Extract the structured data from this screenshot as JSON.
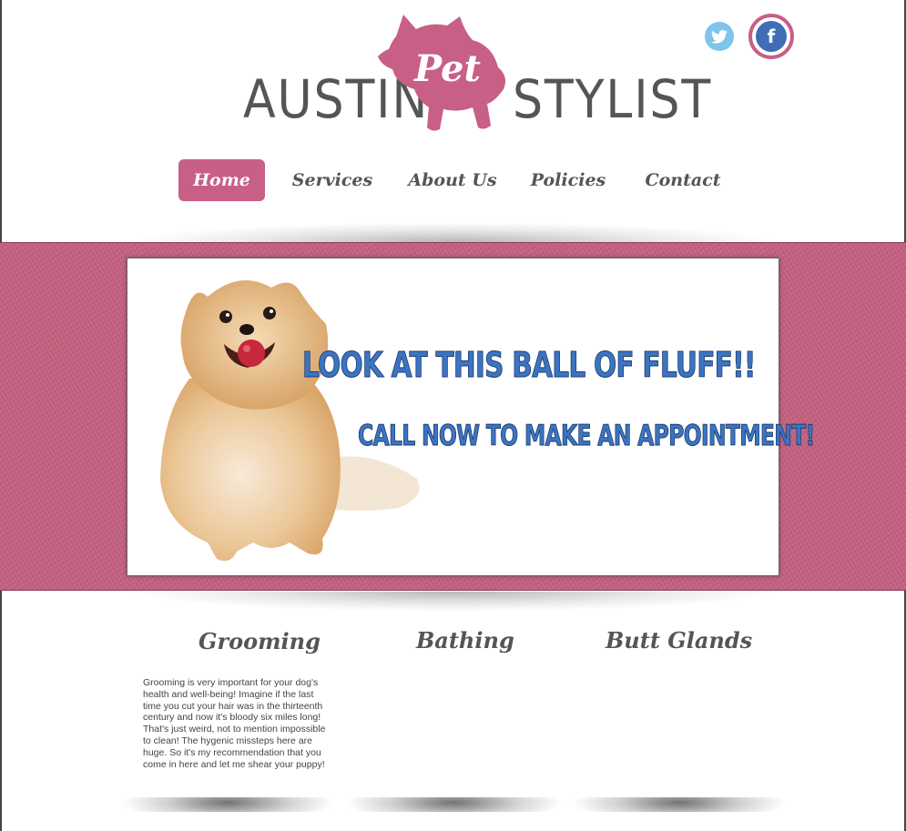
{
  "header": {
    "logo_left": "AUSTIN",
    "logo_middle": "Pet",
    "logo_right": "STYLIST",
    "brand_color": "#c75f86",
    "social": [
      {
        "name": "twitter",
        "icon": "twitter-bird-icon",
        "color": "#7fc4ea"
      },
      {
        "name": "facebook",
        "icon": "facebook-f-icon",
        "glyph": "f",
        "color": "#3f6eb5"
      }
    ]
  },
  "nav": {
    "items": [
      {
        "label": "Home",
        "active": true
      },
      {
        "label": "Services",
        "active": false
      },
      {
        "label": "About Us",
        "active": false
      },
      {
        "label": "Policies",
        "active": false
      },
      {
        "label": "Contact",
        "active": false
      }
    ]
  },
  "banner": {
    "headline": "LOOK AT THIS BALL OF FLUFF!!",
    "subline": "CALL NOW TO MAKE AN APPOINTMENT!",
    "image": "pomeranian-dog-with-red-ball-photo",
    "background_color": "#c2607f",
    "text_color": "#3c74c2"
  },
  "services": [
    {
      "title": "Grooming",
      "text": "Grooming is very important for your dog's health and well-being! Imagine if the last time you cut your hair was in the thirteenth century and now it's bloody six miles long! That's just weird, not to mention impossible to clean! The hygenic missteps here are huge. So it's my recommendation that you come in here and let me shear your puppy!"
    },
    {
      "title": "Bathing",
      "text": ""
    },
    {
      "title": "Butt Glands",
      "text": ""
    }
  ]
}
